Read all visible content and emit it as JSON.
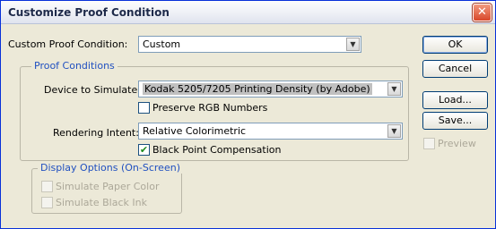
{
  "dialog": {
    "title": "Customize Proof Condition",
    "close_glyph": "✕"
  },
  "custom_condition": {
    "label": "Custom Proof Condition:",
    "value": "Custom"
  },
  "proof_conditions": {
    "legend": "Proof Conditions",
    "device_label": "Device to Simulate:",
    "device_value": "Kodak 5205/7205 Printing Density (by Adobe)",
    "preserve_rgb": {
      "label": "Preserve RGB Numbers",
      "checked": false
    },
    "intent_label": "Rendering Intent:",
    "intent_value": "Relative Colorimetric",
    "black_point": {
      "label": "Black Point Compensation",
      "checked": true
    }
  },
  "display_options": {
    "legend": "Display Options (On-Screen)",
    "paper_color": {
      "label": "Simulate Paper Color",
      "enabled": false
    },
    "black_ink": {
      "label": "Simulate Black Ink",
      "enabled": false
    }
  },
  "buttons": {
    "ok": "OK",
    "cancel": "Cancel",
    "load": "Load...",
    "save": "Save..."
  },
  "preview": {
    "label": "Preview",
    "enabled": false
  },
  "glyphs": {
    "dropdown": "▼",
    "check": "✔"
  },
  "colors": {
    "legend_blue": "#2050c0",
    "dialog_bg": "#ece9d8",
    "xp_close": "#d8472a"
  }
}
